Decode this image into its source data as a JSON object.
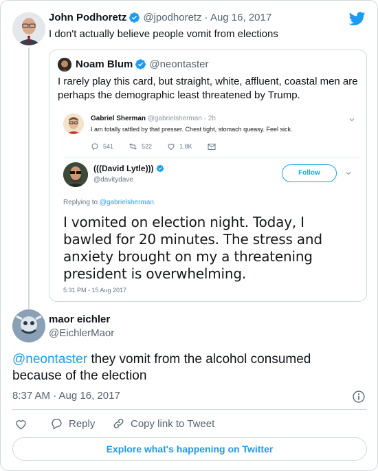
{
  "colors": {
    "accent": "#1d9bf0",
    "text": "#0f1419",
    "muted": "#536471",
    "border": "#cfd9de"
  },
  "parent_tweet": {
    "name": "John Podhoretz",
    "handle": "@jpodhoretz",
    "date": "· Aug 16, 2017",
    "text": "I don't actually believe people vomit from elections",
    "icons": [
      "verified-badge-icon",
      "twitter-bird-icon"
    ]
  },
  "quoted_tweet": {
    "name": "Noam Blum",
    "handle": "@neontaster",
    "text": "I rarely play this card, but straight, white, affluent, coastal men are perhaps the demographic least threatened by Trump.",
    "screenshot": {
      "first_tweet": {
        "name": "Gabriel Sherman",
        "handle": "@gabrielsherman · 2h",
        "text": "I am totally rattled by that presser. Chest tight, stomach queasy. Feel sick.",
        "replies": "541",
        "retweets": "522",
        "likes": "1.8K"
      },
      "second_tweet": {
        "name": "(((David Lytle)))",
        "handle": "@davitydave",
        "follow_label": "Follow",
        "replying_prefix": "Replying to",
        "replying_to": "@gabrielsherman",
        "text": "I vomited on election night. Today, I bawled for 20 minutes. The stress and anxiety brought on my a threatening president is overwhelming.",
        "time": "5:31 PM - 15 Aug 2017"
      }
    }
  },
  "main_tweet": {
    "name": "maor eichler",
    "handle": "@EichlerMaor",
    "mention": "@neontaster",
    "text": " they vomit from the alcohol consumed because of the election",
    "time": "8:37 AM · Aug 16, 2017",
    "actions": {
      "reply_label": "Reply",
      "copy_label": "Copy link to Tweet"
    },
    "explore_label": "Explore what's happening on Twitter"
  }
}
